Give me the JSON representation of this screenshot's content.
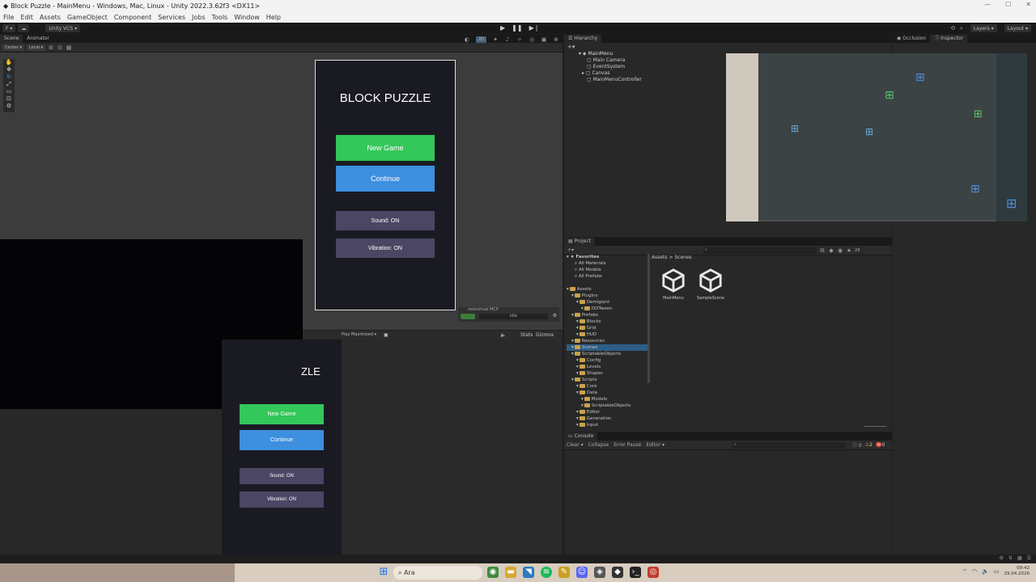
{
  "window": {
    "title": "Block Puzzle - MainMenu - Windows, Mac, Linux - Unity 2022.3.62f3 <DX11>"
  },
  "menu": [
    "File",
    "Edit",
    "Assets",
    "GameObject",
    "Component",
    "Services",
    "Jobs",
    "Tools",
    "Window",
    "Help"
  ],
  "toolbar": {
    "account": "F",
    "vcs": "Unity VCS",
    "layers": "Layers",
    "layout": "Layout"
  },
  "scene": {
    "tabs": [
      "Scene",
      "Animator"
    ],
    "pivot": "Center",
    "space": "Local",
    "mode_2d": "2D"
  },
  "game_ui": {
    "title": "BLOCK PUZZLE",
    "title_partial": "ZLE",
    "new_game": "New Game",
    "continue": "Continue",
    "sound": "Sound: ON",
    "vibration": "Vibration: ON"
  },
  "mcp": {
    "label": "realvirtual MCP",
    "status": "Idle"
  },
  "game_view": {
    "play_mode": "Play Maximized",
    "stats": "Stats",
    "gizmos": "Gizmos"
  },
  "hierarchy": {
    "tab": "Hierarchy",
    "scene": "MainMenu",
    "items": [
      "Main Camera",
      "EventSystem",
      "Canvas",
      "MainMenuController"
    ]
  },
  "inspector": {
    "tabs": [
      "Occlusion",
      "Inspector"
    ]
  },
  "project": {
    "tab": "Project",
    "breadcrumb": [
      "Assets",
      "Scenes"
    ],
    "count": "28",
    "favorites_label": "Favorites",
    "favorites": [
      "All Materials",
      "All Models",
      "All Prefabs"
    ],
    "tree": [
      {
        "label": "Assets",
        "depth": 0
      },
      {
        "label": "Plugins",
        "depth": 1
      },
      {
        "label": "Demigiant",
        "depth": 2
      },
      {
        "label": "DOTween",
        "depth": 3
      },
      {
        "label": "Prefabs",
        "depth": 1
      },
      {
        "label": "Blocks",
        "depth": 2
      },
      {
        "label": "Grid",
        "depth": 2
      },
      {
        "label": "HUD",
        "depth": 2
      },
      {
        "label": "Resources",
        "depth": 1
      },
      {
        "label": "Scenes",
        "depth": 1
      },
      {
        "label": "ScriptableObjects",
        "depth": 1
      },
      {
        "label": "Config",
        "depth": 2
      },
      {
        "label": "Levels",
        "depth": 2
      },
      {
        "label": "Shapes",
        "depth": 2
      },
      {
        "label": "Scripts",
        "depth": 1
      },
      {
        "label": "Core",
        "depth": 2
      },
      {
        "label": "Data",
        "depth": 2
      },
      {
        "label": "Models",
        "depth": 3
      },
      {
        "label": "ScriptableObjects",
        "depth": 3
      },
      {
        "label": "Editor",
        "depth": 2
      },
      {
        "label": "Generation",
        "depth": 2
      },
      {
        "label": "Input",
        "depth": 2
      }
    ],
    "assets": [
      "MainMenu",
      "SampleScene"
    ]
  },
  "console": {
    "tab": "Console",
    "clear": "Clear",
    "collapse": "Collapse",
    "error_pause": "Error Pause",
    "editor": "Editor",
    "counts": [
      "0",
      "2",
      "0"
    ]
  },
  "taskbar": {
    "search": "Ara",
    "time": "09:42",
    "date": "29.04.2026"
  },
  "colors": {
    "green_button": "#34c759",
    "blue_button": "#3d8fe0",
    "purple_button": "#4a4663",
    "editor_bg": "#282828"
  }
}
